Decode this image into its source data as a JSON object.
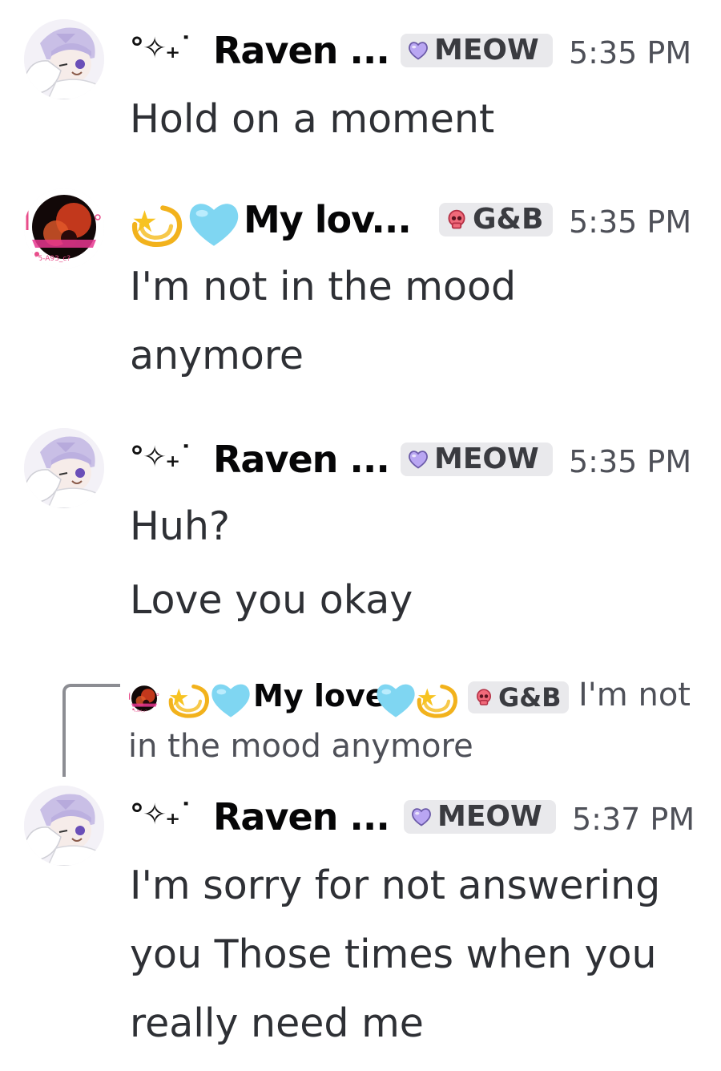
{
  "messages": [
    {
      "author_decoration": "°✧₊˙",
      "author": "Raven ...",
      "tag": "MEOW",
      "tag_icon": "purple-heart-icon",
      "time": "5:35 PM",
      "lines": [
        "Hold on a moment"
      ]
    },
    {
      "author": "My lov...",
      "author_emojis": [
        "dizzy-star-icon",
        "light-blue-heart-icon"
      ],
      "tag": "G&B",
      "tag_icon": "red-skull-icon",
      "time": "5:35 PM",
      "lines": [
        "I'm not in the mood",
        "anymore"
      ]
    },
    {
      "author_decoration": "°✧₊˙",
      "author": "Raven ...",
      "tag": "MEOW",
      "tag_icon": "purple-heart-icon",
      "time": "5:35 PM",
      "lines": [
        "Huh?",
        "Love you okay"
      ]
    },
    {
      "reply": {
        "author": "My love",
        "tag": "G&B",
        "text_part1": "I'm not",
        "text_part2": "in the mood anymore"
      },
      "author_decoration": "°✧₊˙",
      "author": "Raven ...",
      "tag": "MEOW",
      "tag_icon": "purple-heart-icon",
      "time": "5:37 PM",
      "lines": [
        "I'm sorry for not answering",
        "you Those times when you",
        "really need me"
      ]
    }
  ],
  "colors": {
    "tag_bg": "#e9e9ec",
    "purple_heart": "#b9a6f2",
    "red_skull": "#f06a7a",
    "light_blue_heart": "#7fd6f2",
    "timestamp": "#4e5058"
  }
}
